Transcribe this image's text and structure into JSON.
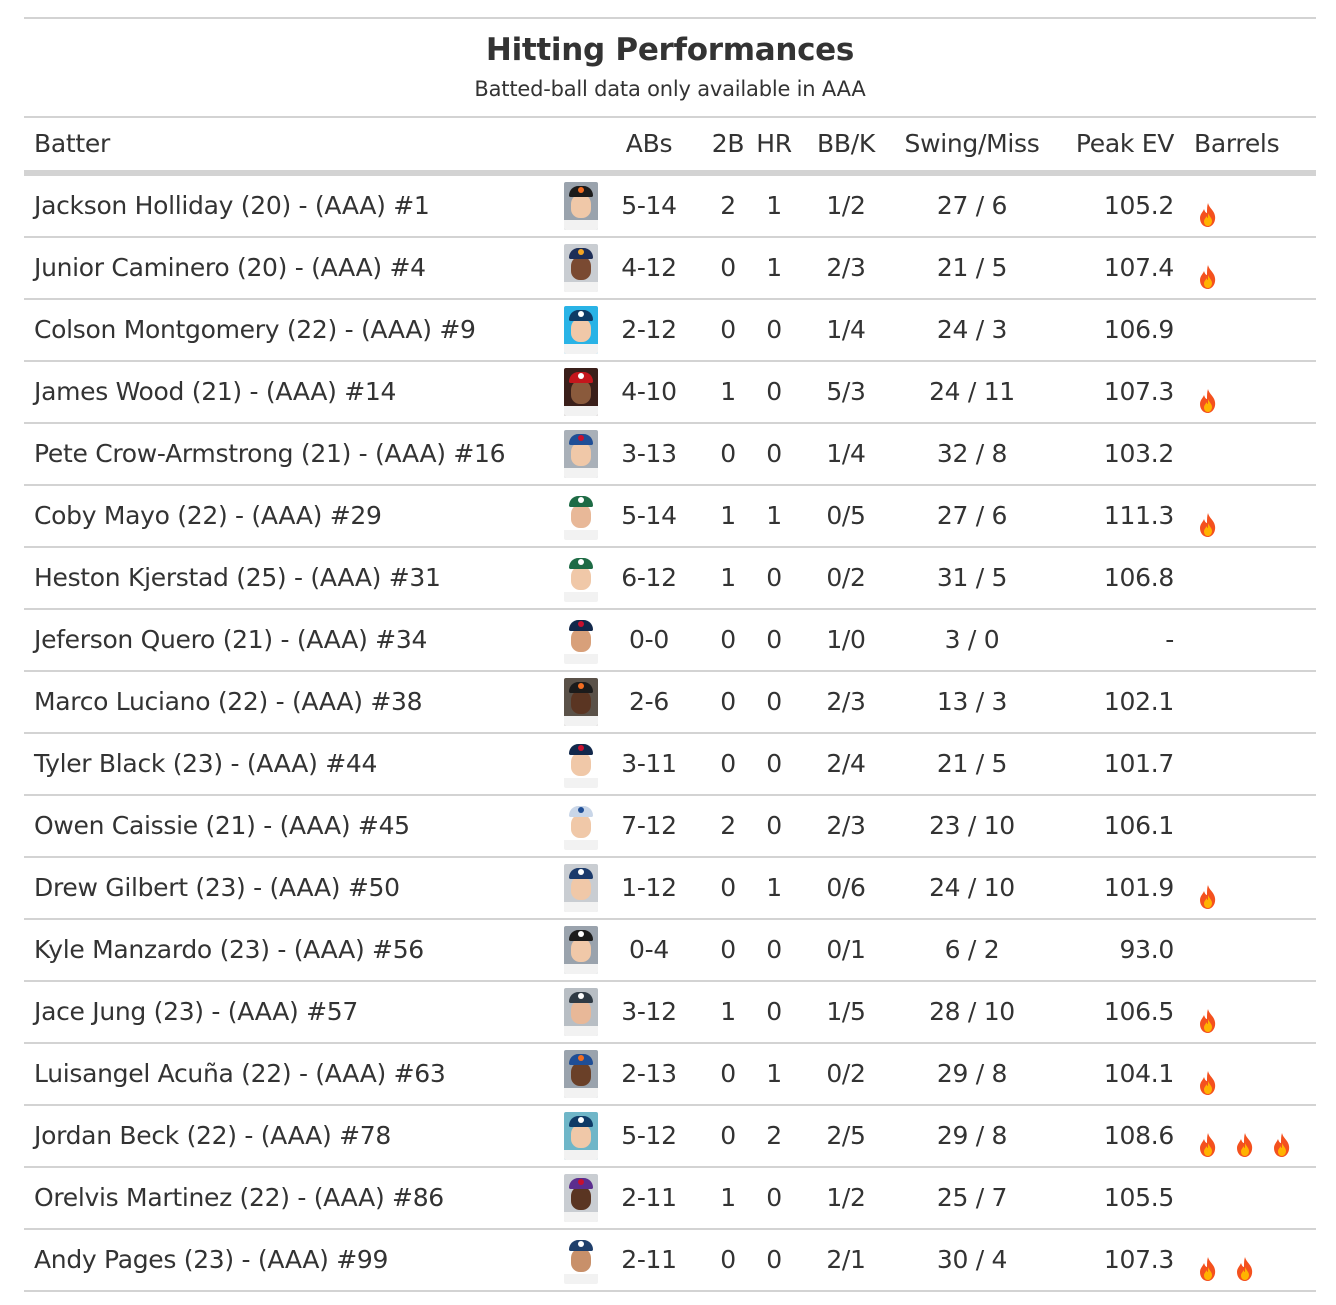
{
  "title": "Hitting Performances",
  "subtitle": "Batted-ball data only available in AAA",
  "columns": {
    "batter": "Batter",
    "abs": "ABs",
    "doubles": "2B",
    "hr": "HR",
    "bbk": "BB/K",
    "swing_miss": "Swing/Miss",
    "peak_ev": "Peak EV",
    "barrels": "Barrels"
  },
  "colors": {
    "rule": "#d3d3d3",
    "text": "#333333",
    "fire_outer": "#f4511e",
    "fire_inner": "#ffb300"
  },
  "rows": [
    {
      "batter": "Jackson Holliday (20) - (AAA) #1",
      "abs": "5-14",
      "doubles": "2",
      "hr": "1",
      "bbk": "1/2",
      "swing_miss": "27 / 6",
      "peak_ev": "105.2",
      "barrels": 1,
      "headshot": "player-photo",
      "bg": "#9aa3ad",
      "cap": "#1b1b1b",
      "logo": "#f26d21",
      "skin": "#f0c8a8"
    },
    {
      "batter": "Junior Caminero (20) - (AAA) #4",
      "abs": "4-12",
      "doubles": "0",
      "hr": "1",
      "bbk": "2/3",
      "swing_miss": "21 / 5",
      "peak_ev": "107.4",
      "barrels": 1,
      "headshot": "player-photo",
      "bg": "#c9cdd2",
      "cap": "#1d2e57",
      "logo": "#f5a623",
      "skin": "#7a4a32"
    },
    {
      "batter": "Colson Montgomery (22) - (AAA) #9",
      "abs": "2-12",
      "doubles": "0",
      "hr": "0",
      "bbk": "1/4",
      "swing_miss": "24 / 3",
      "peak_ev": "106.9",
      "barrels": 0,
      "headshot": "player-photo",
      "bg": "#29b3e6",
      "cap": "#0e3a66",
      "logo": "#ffffff",
      "skin": "#f0c8a8"
    },
    {
      "batter": "James Wood (21) - (AAA) #14",
      "abs": "4-10",
      "doubles": "1",
      "hr": "0",
      "bbk": "5/3",
      "swing_miss": "24 / 11",
      "peak_ev": "107.3",
      "barrels": 1,
      "headshot": "player-photo",
      "bg": "#3a1f1a",
      "cap": "#c4161c",
      "logo": "#ffffff",
      "skin": "#8a5a3c"
    },
    {
      "batter": "Pete Crow-Armstrong (21) - (AAA) #16",
      "abs": "3-13",
      "doubles": "0",
      "hr": "0",
      "bbk": "1/4",
      "swing_miss": "32 / 8",
      "peak_ev": "103.2",
      "barrels": 0,
      "headshot": "player-photo",
      "bg": "#a9b0b8",
      "cap": "#1f4e96",
      "logo": "#c8102e",
      "skin": "#f0c8a8"
    },
    {
      "batter": "Coby Mayo (22) - (AAA) #29",
      "abs": "5-14",
      "doubles": "1",
      "hr": "1",
      "bbk": "0/5",
      "swing_miss": "27 / 6",
      "peak_ev": "111.3",
      "barrels": 1,
      "headshot": "player-photo",
      "bg": "#ffffff",
      "cap": "#1e6b45",
      "logo": "#ffffff",
      "skin": "#e8b898"
    },
    {
      "batter": "Heston Kjerstad (25) - (AAA) #31",
      "abs": "6-12",
      "doubles": "1",
      "hr": "0",
      "bbk": "0/2",
      "swing_miss": "31 / 5",
      "peak_ev": "106.8",
      "barrels": 0,
      "headshot": "player-photo",
      "bg": "#ffffff",
      "cap": "#1e6b45",
      "logo": "#ffffff",
      "skin": "#f0c8a8"
    },
    {
      "batter": "Jeferson Quero (21) - (AAA) #34",
      "abs": "0-0",
      "doubles": "0",
      "hr": "0",
      "bbk": "1/0",
      "swing_miss": "3 / 0",
      "peak_ev": "-",
      "barrels": 0,
      "headshot": "player-photo",
      "bg": "#ffffff",
      "cap": "#12284b",
      "logo": "#c8102e",
      "skin": "#d8a07a"
    },
    {
      "batter": "Marco Luciano (22) - (AAA) #38",
      "abs": "2-6",
      "doubles": "0",
      "hr": "0",
      "bbk": "2/3",
      "swing_miss": "13 / 3",
      "peak_ev": "102.1",
      "barrels": 0,
      "headshot": "player-photo",
      "bg": "#5a5148",
      "cap": "#1b1b1b",
      "logo": "#f26d21",
      "skin": "#5a3522"
    },
    {
      "batter": "Tyler Black (23) - (AAA) #44",
      "abs": "3-11",
      "doubles": "0",
      "hr": "0",
      "bbk": "2/4",
      "swing_miss": "21 / 5",
      "peak_ev": "101.7",
      "barrels": 0,
      "headshot": "player-photo",
      "bg": "#ffffff",
      "cap": "#12284b",
      "logo": "#c8102e",
      "skin": "#f0c8a8"
    },
    {
      "batter": "Owen Caissie (21) - (AAA) #45",
      "abs": "7-12",
      "doubles": "2",
      "hr": "0",
      "bbk": "2/3",
      "swing_miss": "23 / 10",
      "peak_ev": "106.1",
      "barrels": 0,
      "headshot": "player-photo",
      "bg": "#ffffff",
      "cap": "#c9d6e8",
      "logo": "#1f4e96",
      "skin": "#f0c8a8"
    },
    {
      "batter": "Drew Gilbert (23) - (AAA) #50",
      "abs": "1-12",
      "doubles": "0",
      "hr": "1",
      "bbk": "0/6",
      "swing_miss": "24 / 10",
      "peak_ev": "101.9",
      "barrels": 1,
      "headshot": "player-photo",
      "bg": "#c9cdd2",
      "cap": "#1b3a6b",
      "logo": "#ffffff",
      "skin": "#f0c8a8"
    },
    {
      "batter": "Kyle Manzardo (23) - (AAA) #56",
      "abs": "0-4",
      "doubles": "0",
      "hr": "0",
      "bbk": "0/1",
      "swing_miss": "6 / 2",
      "peak_ev": "93.0",
      "barrels": 0,
      "headshot": "player-photo",
      "bg": "#9aa3ad",
      "cap": "#1b1b1b",
      "logo": "#ffffff",
      "skin": "#f0c8a8"
    },
    {
      "batter": "Jace Jung (23) - (AAA) #57",
      "abs": "3-12",
      "doubles": "1",
      "hr": "0",
      "bbk": "1/5",
      "swing_miss": "28 / 10",
      "peak_ev": "106.5",
      "barrels": 1,
      "headshot": "player-photo",
      "bg": "#b8bec4",
      "cap": "#2f3a44",
      "logo": "#ffffff",
      "skin": "#e8b898"
    },
    {
      "batter": "Luisangel Acuña (22) - (AAA) #63",
      "abs": "2-13",
      "doubles": "0",
      "hr": "1",
      "bbk": "0/2",
      "swing_miss": "29 / 8",
      "peak_ev": "104.1",
      "barrels": 1,
      "headshot": "player-photo",
      "bg": "#9aa3ad",
      "cap": "#1f4e96",
      "logo": "#f26d21",
      "skin": "#6a4028"
    },
    {
      "batter": "Jordan Beck (22) - (AAA) #78",
      "abs": "5-12",
      "doubles": "0",
      "hr": "2",
      "bbk": "2/5",
      "swing_miss": "29 / 8",
      "peak_ev": "108.6",
      "barrels": 3,
      "headshot": "player-photo",
      "bg": "#6fb6c8",
      "cap": "#0e3a66",
      "logo": "#ffffff",
      "skin": "#f0c8a8"
    },
    {
      "batter": "Orelvis Martinez (22) - (AAA) #86",
      "abs": "2-11",
      "doubles": "1",
      "hr": "0",
      "bbk": "1/2",
      "swing_miss": "25 / 7",
      "peak_ev": "105.5",
      "barrels": 0,
      "headshot": "player-photo",
      "bg": "#c9cdd2",
      "cap": "#5b2d8e",
      "logo": "#c8102e",
      "skin": "#5a3522"
    },
    {
      "batter": "Andy Pages (23) - (AAA) #99",
      "abs": "2-11",
      "doubles": "0",
      "hr": "0",
      "bbk": "2/1",
      "swing_miss": "30 / 4",
      "peak_ev": "107.3",
      "barrels": 2,
      "headshot": "player-photo",
      "bg": "#ffffff",
      "cap": "#1f3f6b",
      "logo": "#ffffff",
      "skin": "#c8906a"
    }
  ]
}
